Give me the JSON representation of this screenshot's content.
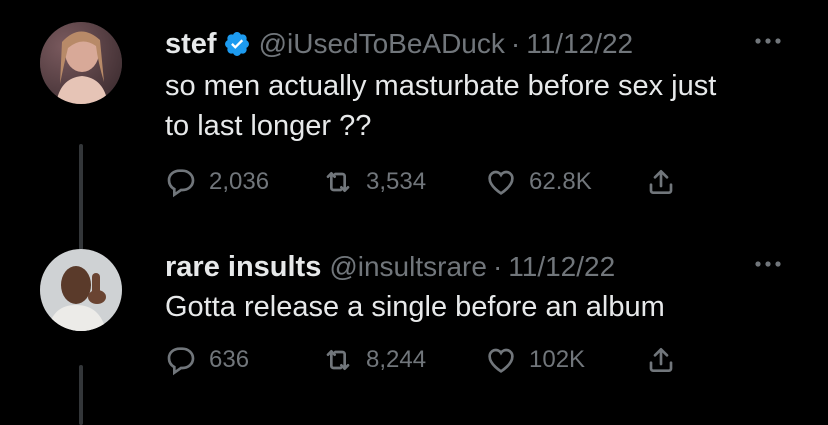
{
  "tweets": [
    {
      "name": "stef",
      "verified": true,
      "handle": "@iUsedToBeADuck",
      "separator": "·",
      "date": "11/12/22",
      "text_lines": [
        "so men actually masturbate before sex just",
        "to last longer ??"
      ],
      "replies": "2,036",
      "retweets": "3,534",
      "likes": "62.8K"
    },
    {
      "name": "rare insults",
      "verified": false,
      "handle": "@insultsrare",
      "separator": "·",
      "date": "11/12/22",
      "text_lines": [
        "Gotta release a single before an album"
      ],
      "replies": "636",
      "retweets": "8,244",
      "likes": "102K"
    }
  ],
  "colors": {
    "background": "#000000",
    "primary_text": "#e7e9ea",
    "secondary_text": "#71767b",
    "verified_badge": "#1d9bf0",
    "thread_line": "#333639"
  },
  "icons": [
    "verified-badge-icon",
    "more-options-icon",
    "reply-icon",
    "retweet-icon",
    "like-icon",
    "share-icon"
  ]
}
